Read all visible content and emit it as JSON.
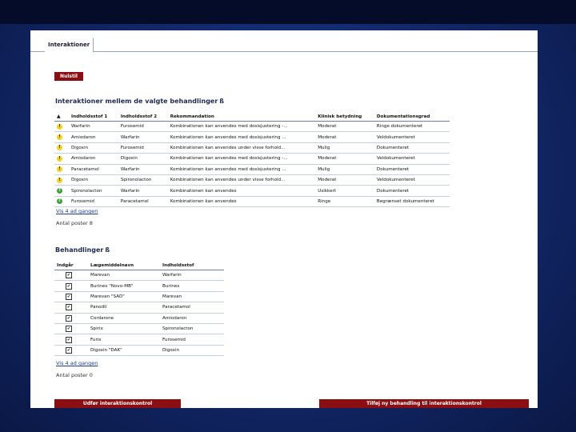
{
  "tab_label": "Interaktioner",
  "nulstil_label": "Nulstil",
  "interactions": {
    "title": "Interaktioner mellem de valgte behandlinger",
    "help_glyph": "ß",
    "sort_glyph": "▲",
    "columns": [
      "Indholdsstof 1",
      "Indholdsstof 2",
      "Rekommandation",
      "Klinisk betydning",
      "Dokumentationsgrad"
    ],
    "rows": [
      {
        "icon": "!",
        "color": "yellow",
        "a": "Warfarin",
        "b": "Furosemid",
        "rec": "Kombinationen kan anvendes med dosisjustering -...",
        "klin": "Moderat",
        "dok": "Ringe dokumenteret"
      },
      {
        "icon": "!",
        "color": "yellow",
        "a": "Amiodaron",
        "b": "Warfarin",
        "rec": "Kombinationen kan anvendes med dosisjustering ...",
        "klin": "Moderat",
        "dok": "Veldokumenteret"
      },
      {
        "icon": "!",
        "color": "yellow",
        "a": "Digoxin",
        "b": "Furosemid",
        "rec": "Kombinationen kan anvendes under visse forhold...",
        "klin": "Mulig",
        "dok": "Dokumenteret"
      },
      {
        "icon": "!",
        "color": "yellow",
        "a": "Amiodaron",
        "b": "Digoxin",
        "rec": "Kombinationen kan anvendes med dosisjustering -...",
        "klin": "Moderat",
        "dok": "Veldokumenteret"
      },
      {
        "icon": "!",
        "color": "yellow",
        "a": "Paracetamol",
        "b": "Warfarin",
        "rec": "Kombinationen kan anvendes med dosisjustering ...",
        "klin": "Mulig",
        "dok": "Dokumenteret"
      },
      {
        "icon": "!",
        "color": "yellow",
        "a": "Digoxin",
        "b": "Spironolacton",
        "rec": "Kombinationen kan anvendes under visse forhold...",
        "klin": "Moderat",
        "dok": "Veldokumenteret"
      },
      {
        "icon": "?",
        "color": "green",
        "a": "Spironolacton",
        "b": "Warfarin",
        "rec": "Kombinationen kan anvendes",
        "klin": "Usikkert",
        "dok": "Dokumenteret"
      },
      {
        "icon": "?",
        "color": "green",
        "a": "Furosemid",
        "b": "Paracetamol",
        "rec": "Kombinationen kan anvendes",
        "klin": "Ringe",
        "dok": "Begrænset dokumenteret"
      }
    ],
    "show_link": "Vis 4 ad gangen",
    "count": "Antal poster 8"
  },
  "treatments": {
    "title": "Behandlinger",
    "help_glyph": "ß",
    "columns": [
      "Indgår",
      "Lægemiddelnavn",
      "Indholdsstof"
    ],
    "rows": [
      {
        "name": "Marevan",
        "stof": "Warfarin"
      },
      {
        "name": "Burinex \"Novo-MB\"",
        "stof": "Burinex"
      },
      {
        "name": "Marevan \"SAD\"",
        "stof": "Marevan"
      },
      {
        "name": "Panodil",
        "stof": "Paracetamol"
      },
      {
        "name": "Cordarone",
        "stof": "Amiodaron"
      },
      {
        "name": "Spirix",
        "stof": "Spironolacton"
      },
      {
        "name": "Furix",
        "stof": "Furosemid"
      },
      {
        "name": "Digoxin \"DAK\"",
        "stof": "Digoxin"
      }
    ],
    "show_link": "Vis 4 ad gangen",
    "count": "Antal poster 0"
  },
  "run_button": "Udfør interaktionskontrol",
  "add_button": "Tilføj ny behandling til interaktionskontrol"
}
